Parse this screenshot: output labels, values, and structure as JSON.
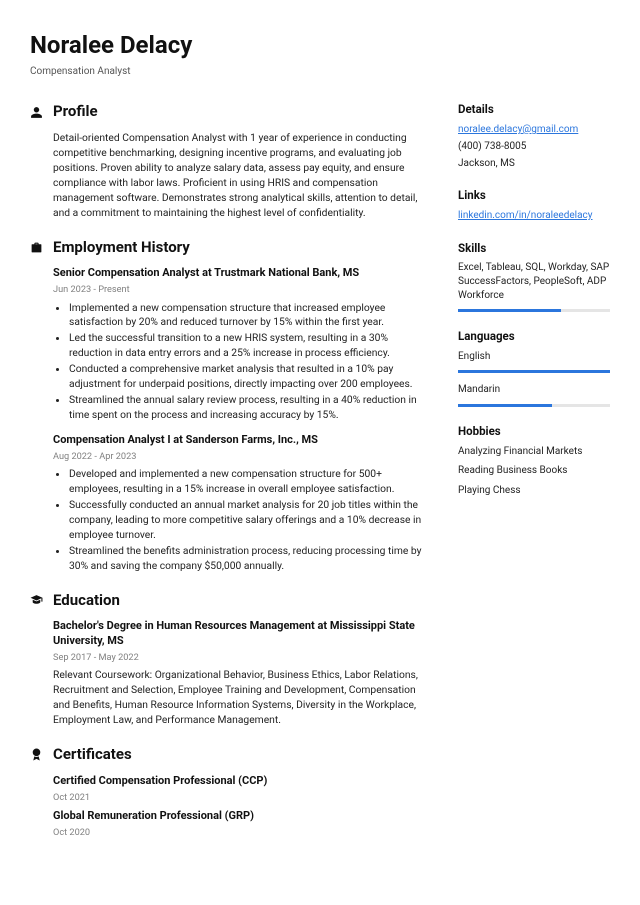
{
  "header": {
    "name": "Noralee Delacy",
    "title": "Compensation Analyst"
  },
  "profile": {
    "heading": "Profile",
    "text": "Detail-oriented Compensation Analyst with 1 year of experience in conducting competitive benchmarking, designing incentive programs, and evaluating job positions. Proven ability to analyze salary data, assess pay equity, and ensure compliance with labor laws. Proficient in using HRIS and compensation management software. Demonstrates strong analytical skills, attention to detail, and a commitment to maintaining the highest level of confidentiality."
  },
  "employment": {
    "heading": "Employment History",
    "entries": [
      {
        "title": "Senior Compensation Analyst at Trustmark National Bank, MS",
        "dates": "Jun 2023 - Present",
        "bullets": [
          "Implemented a new compensation structure that increased employee satisfaction by 20% and reduced turnover by 15% within the first year.",
          "Led the successful transition to a new HRIS system, resulting in a 30% reduction in data entry errors and a 25% increase in process efficiency.",
          "Conducted a comprehensive market analysis that resulted in a 10% pay adjustment for underpaid positions, directly impacting over 200 employees.",
          "Streamlined the annual salary review process, resulting in a 40% reduction in time spent on the process and increasing accuracy by 15%."
        ]
      },
      {
        "title": "Compensation Analyst I at Sanderson Farms, Inc., MS",
        "dates": "Aug 2022 - Apr 2023",
        "bullets": [
          "Developed and implemented a new compensation structure for 500+ employees, resulting in a 15% increase in overall employee satisfaction.",
          "Successfully conducted an annual market analysis for 20 job titles within the company, leading to more competitive salary offerings and a 10% decrease in employee turnover.",
          "Streamlined the benefits administration process, reducing processing time by 30% and saving the company $50,000 annually."
        ]
      }
    ]
  },
  "education": {
    "heading": "Education",
    "entries": [
      {
        "title": "Bachelor's Degree in Human Resources Management at Mississippi State University, MS",
        "dates": "Sep 2017 - May 2022",
        "desc": "Relevant Coursework: Organizational Behavior, Business Ethics, Labor Relations, Recruitment and Selection, Employee Training and Development, Compensation and Benefits, Human Resource Information Systems, Diversity in the Workplace, Employment Law, and Performance Management."
      }
    ]
  },
  "certificates": {
    "heading": "Certificates",
    "entries": [
      {
        "title": "Certified Compensation Professional (CCP)",
        "dates": "Oct 2021"
      },
      {
        "title": "Global Remuneration Professional (GRP)",
        "dates": "Oct 2020"
      }
    ]
  },
  "aside": {
    "details": {
      "heading": "Details",
      "email": "noralee.delacy@gmail.com",
      "phone": "(400) 738-8005",
      "location": "Jackson, MS"
    },
    "links": {
      "heading": "Links",
      "items": [
        "linkedin.com/in/noraleedelacy"
      ]
    },
    "skills": {
      "heading": "Skills",
      "text": "Excel, Tableau, SQL, Workday, SAP SuccessFactors, PeopleSoft, ADP Workforce",
      "level": 68
    },
    "languages": {
      "heading": "Languages",
      "items": [
        {
          "name": "English",
          "level": 100
        },
        {
          "name": "Mandarin",
          "level": 62
        }
      ]
    },
    "hobbies": {
      "heading": "Hobbies",
      "items": [
        "Analyzing Financial Markets",
        "Reading Business Books",
        "Playing Chess"
      ]
    }
  }
}
